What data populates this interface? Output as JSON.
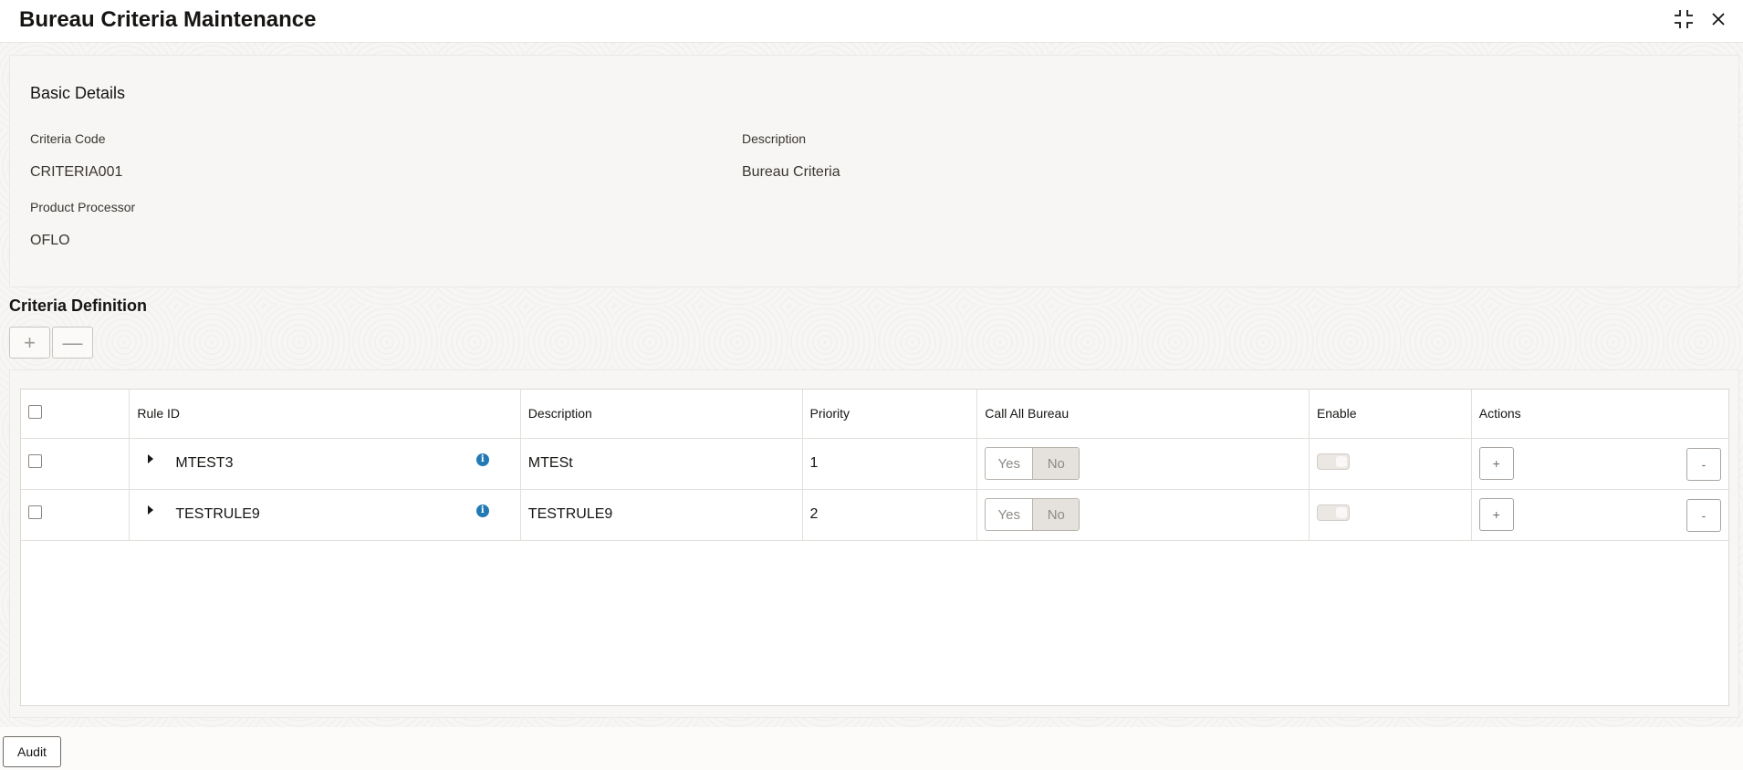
{
  "header": {
    "title": "Bureau Criteria Maintenance",
    "icons": [
      "collapse-icon",
      "close-icon"
    ]
  },
  "basic_details": {
    "title": "Basic Details",
    "criteria_code_label": "Criteria Code",
    "criteria_code_value": "CRITERIA001",
    "description_label": "Description",
    "description_value": "Bureau Criteria",
    "product_processor_label": "Product Processor",
    "product_processor_value": "OFLO"
  },
  "criteria_definition": {
    "title": "Criteria Definition",
    "add_label": "+",
    "remove_label": "—"
  },
  "table": {
    "headers": {
      "rule_id": "Rule ID",
      "description": "Description",
      "priority": "Priority",
      "call_all_bureau": "Call All Bureau",
      "enable": "Enable",
      "actions": "Actions"
    },
    "rows": [
      {
        "rule_id": "MTEST3",
        "description": "MTESt",
        "priority": "1",
        "yes": "Yes",
        "no": "No",
        "add": "+",
        "remove": "-"
      },
      {
        "rule_id": "TESTRULE9",
        "description": "TESTRULE9",
        "priority": "2",
        "yes": "Yes",
        "no": "No",
        "add": "+",
        "remove": "-"
      }
    ]
  },
  "footer": {
    "audit_label": "Audit"
  }
}
